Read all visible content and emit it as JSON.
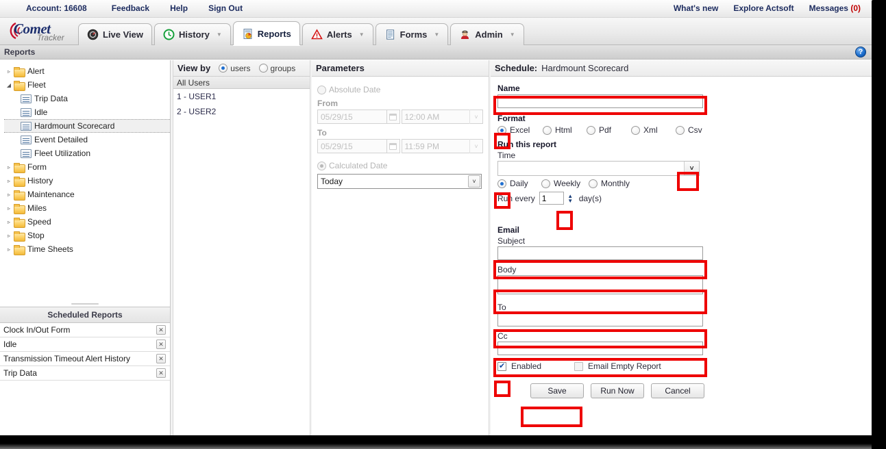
{
  "topbar": {
    "account": "Account: 16608",
    "links_left": [
      "Feedback",
      "Help",
      "Sign Out"
    ],
    "links_right": [
      "What's new",
      "Explore Actsoft"
    ],
    "messages_label": "Messages",
    "messages_count": "(0)"
  },
  "brand": {
    "name": "Comet",
    "sub": "Tracker"
  },
  "tabs": [
    {
      "label": "Live View",
      "icon": "gauge-icon",
      "caret": "",
      "active": false
    },
    {
      "label": "History",
      "icon": "clock-icon",
      "caret": "▼",
      "active": false
    },
    {
      "label": "Reports",
      "icon": "report-chart-icon",
      "caret": "",
      "active": true
    },
    {
      "label": "Alerts",
      "icon": "warning-triangle-icon",
      "caret": "▼",
      "active": false
    },
    {
      "label": "Forms",
      "icon": "document-icon",
      "caret": "▼",
      "active": false
    },
    {
      "label": "Admin",
      "icon": "user-admin-icon",
      "caret": "▼",
      "active": false
    }
  ],
  "section": {
    "title": "Reports",
    "help_icon": "help-question-icon",
    "help_glyph": "?"
  },
  "tree": [
    {
      "label": "Alert",
      "type": "folder",
      "expanded": false,
      "twist": "▹",
      "level": 0,
      "selected": false
    },
    {
      "label": "Fleet",
      "type": "folder",
      "expanded": true,
      "twist": "◢",
      "level": 0,
      "selected": false
    },
    {
      "label": "Trip Data",
      "type": "report",
      "twist": "",
      "level": 1,
      "selected": false
    },
    {
      "label": "Idle",
      "type": "report",
      "twist": "",
      "level": 1,
      "selected": false
    },
    {
      "label": "Hardmount Scorecard",
      "type": "report",
      "twist": "",
      "level": 1,
      "selected": true
    },
    {
      "label": "Event Detailed",
      "type": "report",
      "twist": "",
      "level": 1,
      "selected": false
    },
    {
      "label": "Fleet Utilization",
      "type": "report",
      "twist": "",
      "level": 1,
      "selected": false
    },
    {
      "label": "Form",
      "type": "folder",
      "expanded": false,
      "twist": "▹",
      "level": 0,
      "selected": false
    },
    {
      "label": "History",
      "type": "folder",
      "expanded": false,
      "twist": "▹",
      "level": 0,
      "selected": false
    },
    {
      "label": "Maintenance",
      "type": "folder",
      "expanded": false,
      "twist": "▹",
      "level": 0,
      "selected": false
    },
    {
      "label": "Miles",
      "type": "folder",
      "expanded": false,
      "twist": "▹",
      "level": 0,
      "selected": false
    },
    {
      "label": "Speed",
      "type": "folder",
      "expanded": false,
      "twist": "▹",
      "level": 0,
      "selected": false
    },
    {
      "label": "Stop",
      "type": "folder",
      "expanded": false,
      "twist": "▹",
      "level": 0,
      "selected": false
    },
    {
      "label": "Time Sheets",
      "type": "folder",
      "expanded": false,
      "twist": "▹",
      "level": 0,
      "selected": false
    }
  ],
  "scheduled_reports": {
    "title": "Scheduled Reports",
    "remove_glyph": "✕",
    "items": [
      {
        "name": "Clock In/Out Form"
      },
      {
        "name": "Idle"
      },
      {
        "name": "Transmission Timeout Alert History"
      },
      {
        "name": "Trip Data"
      }
    ]
  },
  "view_by": {
    "title": "View by",
    "options": [
      {
        "label": "users",
        "selected": true
      },
      {
        "label": "groups",
        "selected": false
      }
    ],
    "all_users_label": "All Users",
    "users": [
      "1 - USER1",
      "2 - USER2"
    ]
  },
  "parameters": {
    "title": "Parameters",
    "absolute_date": {
      "label": "Absolute Date",
      "selected": false,
      "disabled": true
    },
    "from": {
      "label": "From",
      "date": "05/29/15",
      "time": "12:00 AM"
    },
    "to": {
      "label": "To",
      "date": "05/29/15",
      "time": "11:59 PM"
    },
    "calculated_date": {
      "label": "Calculated Date",
      "selected": true,
      "disabled": true
    },
    "calculated_value": "Today",
    "calendar_icon": "calendar-icon",
    "dropdown_glyph": "˅"
  },
  "schedule": {
    "title_label": "Schedule:",
    "title_value": "Hardmount Scorecard",
    "name_label": "Name",
    "name_value": "",
    "format_label": "Format",
    "formats": [
      {
        "label": "Excel",
        "selected": true
      },
      {
        "label": "Html",
        "selected": false
      },
      {
        "label": "Pdf",
        "selected": false
      },
      {
        "label": "Xml",
        "selected": false
      },
      {
        "label": "Csv",
        "selected": false
      }
    ],
    "run_this_report_label": "Run this report",
    "time_label": "Time",
    "time_value": "",
    "time_dropdown_glyph": "˅",
    "frequencies": [
      {
        "label": "Daily",
        "selected": true
      },
      {
        "label": "Weekly",
        "selected": false
      },
      {
        "label": "Monthly",
        "selected": false
      }
    ],
    "run_every_label": "Run every",
    "run_every_value": "1",
    "run_every_unit": "day(s)",
    "spinner_up_glyph": "▲",
    "spinner_down_glyph": "▼",
    "email_label": "Email",
    "subject_label": "Subject",
    "subject_value": "",
    "body_label": "Body",
    "body_value": "",
    "to_label": "To",
    "to_value": "",
    "cc_label": "Cc",
    "cc_value": "",
    "enabled": {
      "label": "Enabled",
      "checked": true
    },
    "email_empty_report": {
      "label": "Email Empty Report",
      "checked": false
    },
    "buttons": [
      {
        "label": "Save",
        "highlighted": true
      },
      {
        "label": "Run Now",
        "highlighted": false
      },
      {
        "label": "Cancel",
        "highlighted": false
      }
    ]
  },
  "colors": {
    "annotation": "#ee0000",
    "accent": "#1f6fd0",
    "brand_blue": "#1d2f6e",
    "brand_red": "#c8102e",
    "messages_red": "#c00000"
  }
}
